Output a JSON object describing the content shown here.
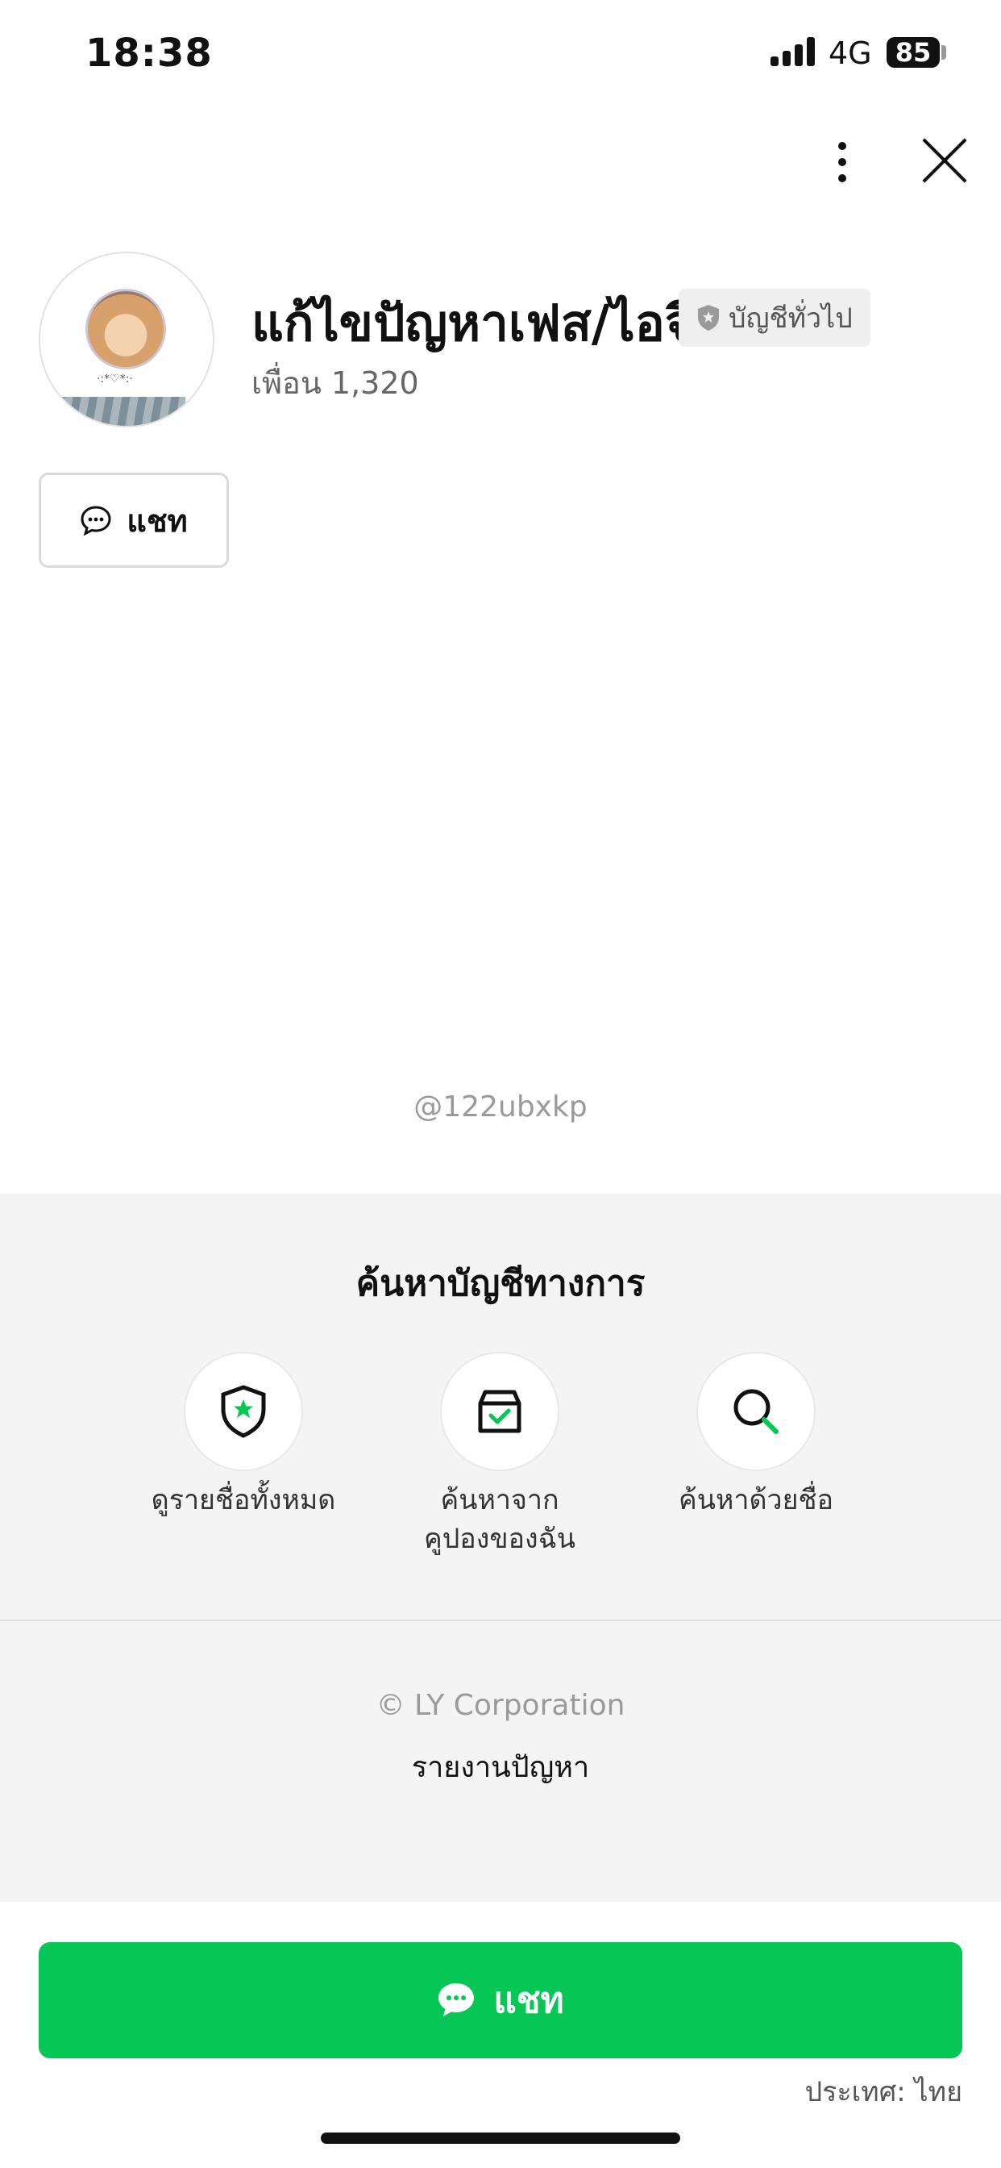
{
  "status_bar": {
    "time": "18:38",
    "network": "4G",
    "battery": "85"
  },
  "profile": {
    "name": "แก้ไขปัญหาเฟส/ไอจี",
    "badge": "บัญชีทั่วไป",
    "friends": "เพื่อน 1,320",
    "avatar_caption": "·:*♡*:·"
  },
  "chat_button_small": "แชท",
  "handle": "@122ubxkp",
  "official_search": {
    "title": "ค้นหาบัญชีทางการ",
    "options": [
      {
        "label": "ดูรายชื่อทั้งหมด",
        "icon": "shield-star-icon"
      },
      {
        "label_line1": "ค้นหาจาก",
        "label_line2": "คูปองของฉัน",
        "icon": "coupon-box-icon"
      },
      {
        "label": "ค้นหาด้วยชื่อ",
        "icon": "search-icon"
      }
    ]
  },
  "footer": {
    "copyright": "© LY Corporation",
    "report": "รายงานปัญหา"
  },
  "chat_button_main": "แชท",
  "country": "ประเทศ: ไทย",
  "colors": {
    "brand_green": "#06c755"
  }
}
